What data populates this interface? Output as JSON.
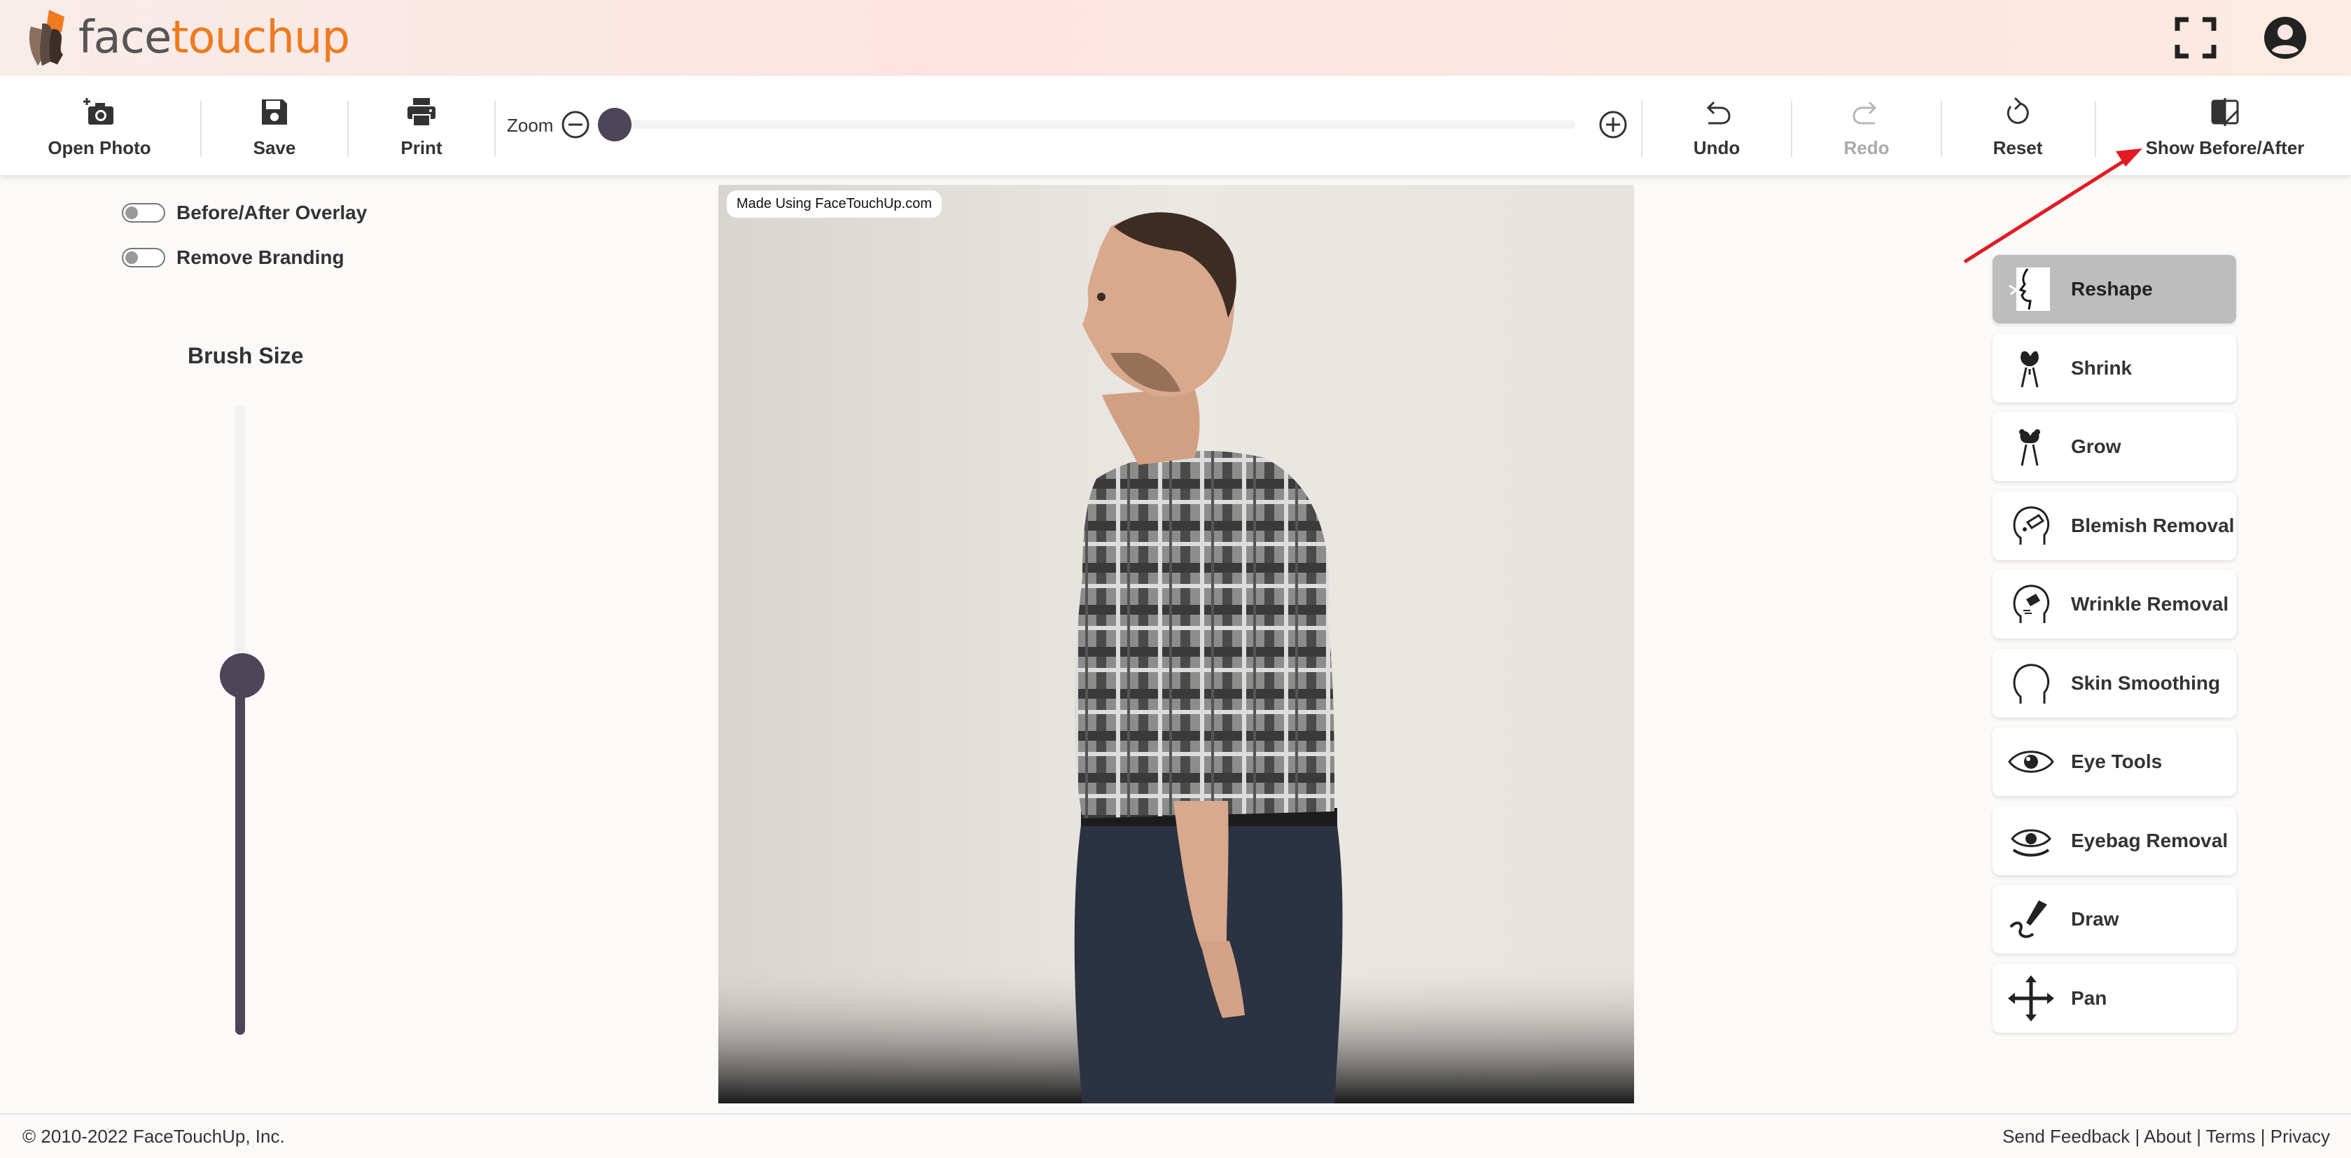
{
  "app": {
    "logo_part1": "face",
    "logo_part2": "touchup",
    "accent_color": "#f07a1e"
  },
  "header": {
    "fullscreen_icon": "fullscreen-icon",
    "account_icon": "account-icon"
  },
  "toolbar": {
    "open_photo": "Open Photo",
    "save": "Save",
    "print": "Print",
    "zoom_label": "Zoom",
    "zoom_level": 0,
    "undo": "Undo",
    "redo": "Redo",
    "reset": "Reset",
    "show_before_after": "Show Before/After"
  },
  "left_panel": {
    "overlay_toggle": "Before/After Overlay",
    "overlay_on": false,
    "branding_toggle": "Remove Branding",
    "branding_on": false,
    "brush_size_title": "Brush Size",
    "brush_size_level": 0.57
  },
  "photo": {
    "watermark": "Made Using FaceTouchUp.com"
  },
  "tools": [
    {
      "label": "Reshape",
      "icon": "reshape-icon",
      "active": true
    },
    {
      "label": "Shrink",
      "icon": "shrink-icon",
      "active": false
    },
    {
      "label": "Grow",
      "icon": "grow-icon",
      "active": false
    },
    {
      "label": "Blemish Removal",
      "icon": "blemish-icon",
      "active": false
    },
    {
      "label": "Wrinkle Removal",
      "icon": "wrinkle-icon",
      "active": false
    },
    {
      "label": "Skin Smoothing",
      "icon": "skin-smoothing-icon",
      "active": false
    },
    {
      "label": "Eye Tools",
      "icon": "eye-icon",
      "active": false
    },
    {
      "label": "Eyebag Removal",
      "icon": "eyebag-icon",
      "active": false
    },
    {
      "label": "Draw",
      "icon": "draw-icon",
      "active": false
    },
    {
      "label": "Pan",
      "icon": "pan-icon",
      "active": false
    }
  ],
  "footer": {
    "copyright": "© 2010-2022 FaceTouchUp, Inc.",
    "send_feedback": "Send Feedback",
    "about": "About",
    "terms": "Terms",
    "privacy": "Privacy",
    "separator": "|"
  },
  "annotation": {
    "arrow_color": "#e21b23"
  }
}
